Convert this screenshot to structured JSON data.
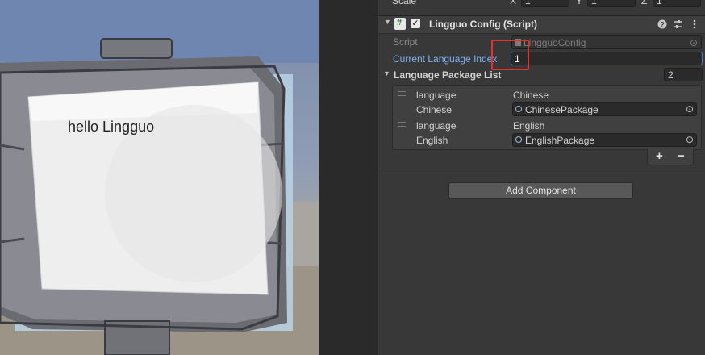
{
  "scene": {
    "sign_text": "hello Lingguo"
  },
  "inspector": {
    "scale_row": {
      "label": "Scale",
      "x_label": "X",
      "x_value": "1",
      "y_label": "Y",
      "y_value": "1",
      "z_label": "Z",
      "z_value": "1"
    },
    "component": {
      "title": "Lingguo Config (Script)",
      "enabled": true,
      "icons": [
        "help-icon",
        "preset-icon",
        "more-icon"
      ]
    },
    "script_field": {
      "label": "Script",
      "value": "LingguoConfig"
    },
    "current_language_index": {
      "label": "Current Language Index",
      "value": "1"
    },
    "language_package_list": {
      "label": "Language Package List",
      "count": "2",
      "items": [
        {
          "language_label": "language",
          "language_value": "Chinese",
          "package_label": "Chinese",
          "package_value": "ChinesePackage"
        },
        {
          "language_label": "language",
          "language_value": "English",
          "package_label": "English",
          "package_value": "EnglishPackage"
        }
      ],
      "add_symbol": "+",
      "remove_symbol": "−"
    },
    "add_component_label": "Add Component"
  },
  "colors": {
    "highlight": "#e8302b",
    "link_label": "#7fb3f2",
    "focused_border": "#3c7bd6"
  }
}
